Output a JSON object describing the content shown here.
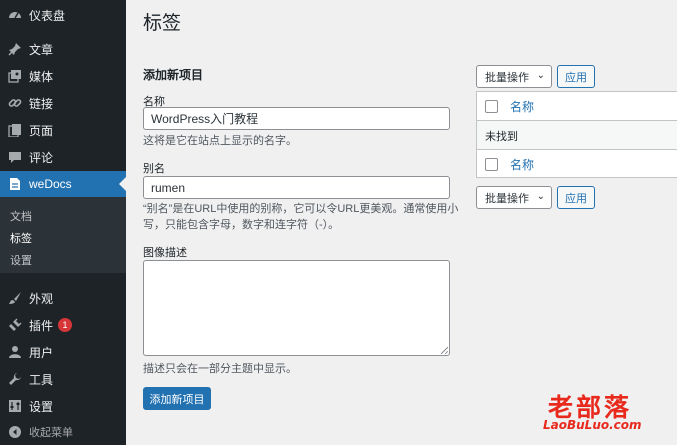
{
  "sidebar": {
    "items": [
      {
        "label": "仪表盘",
        "icon": "dashboard-icon"
      },
      {
        "label": "文章",
        "icon": "pin-icon"
      },
      {
        "label": "媒体",
        "icon": "media-icon"
      },
      {
        "label": "链接",
        "icon": "link-icon"
      },
      {
        "label": "页面",
        "icon": "page-icon"
      },
      {
        "label": "评论",
        "icon": "comment-icon"
      },
      {
        "label": "weDocs",
        "icon": "docs-icon"
      },
      {
        "label": "外观",
        "icon": "brush-icon"
      },
      {
        "label": "插件",
        "icon": "plugin-icon"
      },
      {
        "label": "用户",
        "icon": "user-icon"
      },
      {
        "label": "工具",
        "icon": "wrench-icon"
      },
      {
        "label": "设置",
        "icon": "settings-icon"
      }
    ],
    "plugin_badge": "1",
    "submenu": [
      "文档",
      "标签",
      "设置"
    ],
    "collapse_label": "收起菜单"
  },
  "page": {
    "title": "标签"
  },
  "form": {
    "title": "添加新项目",
    "name_label": "名称",
    "name_value": "WordPress入门教程",
    "name_desc": "这将是它在站点上显示的名字。",
    "slug_label": "别名",
    "slug_value": "rumen",
    "slug_desc_line1": "“别名”是在URL中使用的别称，它可以令URL更美观。通常使用小",
    "slug_desc_line2": "写，只能包含字母，数字和连字符（-）。",
    "image_desc_label": "图像描述",
    "image_desc_note": "描述只会在一部分主题中显示。",
    "submit_label": "添加新项目"
  },
  "table": {
    "bulk_action_label": "批量操作",
    "apply_label": "应用",
    "column_name": "名称",
    "empty_message": "未找到"
  },
  "watermark": {
    "text_cn": "老部落",
    "text_en": "LaoBuLuo.com"
  },
  "colors": {
    "sidebar_bg": "#1d2327",
    "accent": "#2271b1",
    "badge": "#d63638",
    "watermark": "#e8291c"
  }
}
